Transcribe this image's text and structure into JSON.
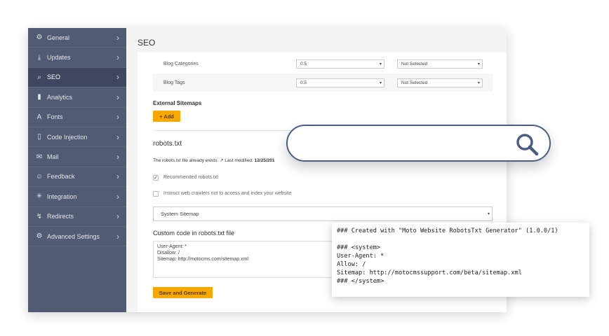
{
  "sidebar": {
    "items": [
      {
        "label": "General",
        "icon": "gear-icon",
        "glyph": "⚙"
      },
      {
        "label": "Updates",
        "icon": "download-icon",
        "glyph": "⤓"
      },
      {
        "label": "SEO",
        "icon": "seo-icon",
        "glyph": "⌕",
        "active": true
      },
      {
        "label": "Analytics",
        "icon": "bar-chart-icon",
        "glyph": "▮"
      },
      {
        "label": "Fonts",
        "icon": "font-icon",
        "glyph": "A"
      },
      {
        "label": "Code Injection",
        "icon": "code-file-icon",
        "glyph": "▯"
      },
      {
        "label": "Mail",
        "icon": "mail-icon",
        "glyph": "✉"
      },
      {
        "label": "Feedback",
        "icon": "feedback-icon",
        "glyph": "☺"
      },
      {
        "label": "Integration",
        "icon": "integration-icon",
        "glyph": "✳"
      },
      {
        "label": "Redirects",
        "icon": "redirect-icon",
        "glyph": "↯"
      },
      {
        "label": "Advanced Settings",
        "icon": "advanced-gear-icon",
        "glyph": "⚙"
      }
    ]
  },
  "page": {
    "title": "SEO"
  },
  "sitemap_rows": [
    {
      "label": "Blog Categories",
      "priority": "0.5",
      "frequency": "Not Selected"
    },
    {
      "label": "Blog Tags",
      "priority": "0.5",
      "frequency": "Not Selected"
    }
  ],
  "external": {
    "title": "External Sitemaps",
    "add_label": "+ Add"
  },
  "robots": {
    "title": "robots.txt",
    "exists_text": "The robots.txt file already exists.",
    "modified_label": "Last modified:",
    "modified_value": "12/25/201",
    "recommended_label": "Recommended robots.txt",
    "recommended_checked": true,
    "noindex_label": "Instruct web crawlers not to access and index your website",
    "noindex_checked": false,
    "sitemap_select": "System Sitemap",
    "custom_label": "Custom code in robots.txt file",
    "custom_code": "User-Agent: *\nDisallow: /\nSitemap: http://motocms.com/sitemap.xml",
    "save_label": "Save and Generate"
  },
  "preview": {
    "code": "### Created with \"Moto Website RobotsTxt Generator\" (1.0.0/1)\n\n### <system>\nUser-Agent: *\nAllow: /\nSitemap: http://motocmssupport.com/beta/sitemap.xml\n### </system>"
  },
  "colors": {
    "sidebar": "#525b74",
    "accent": "#f9a800",
    "search_border": "#4d5c82"
  }
}
